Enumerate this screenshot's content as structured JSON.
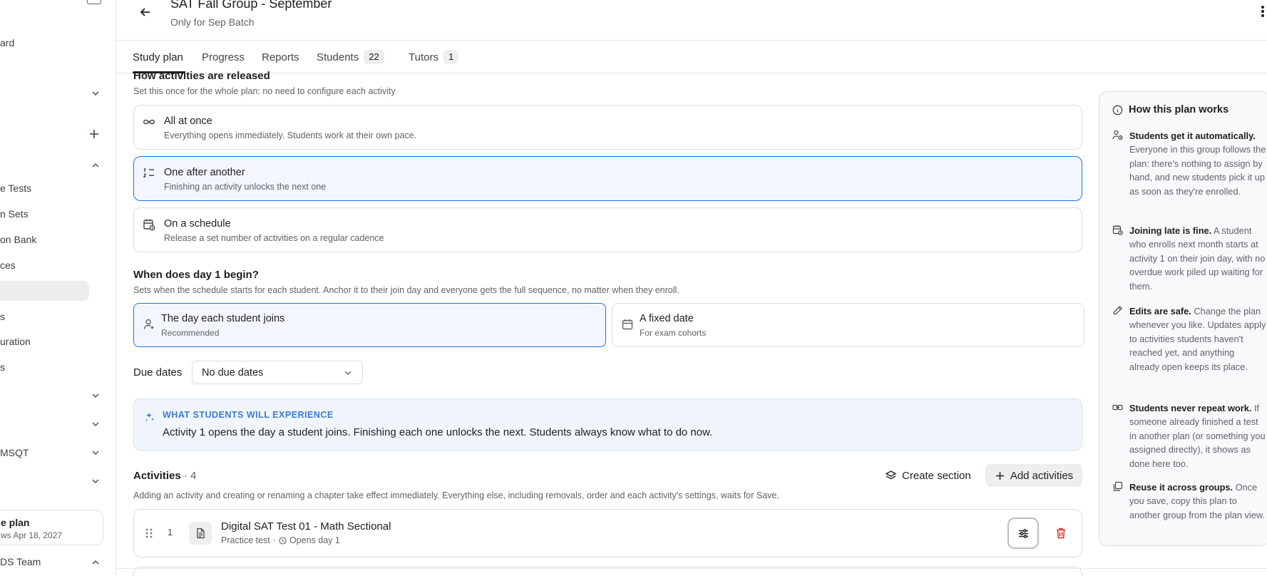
{
  "sidebar": {
    "items": [
      "ard",
      "e Tests",
      "n Sets",
      "on Bank",
      "ces",
      "s",
      "uration",
      "s",
      "MSQT",
      "Team"
    ],
    "plan_card": {
      "title": "e plan",
      "subtitle": "ws Apr 18, 2027"
    },
    "team_label": "DS Team"
  },
  "header": {
    "title": "SAT Fall Group - September",
    "subtitle": "Only for Sep Batch"
  },
  "tabs": [
    {
      "label": "Study plan",
      "badge": ""
    },
    {
      "label": "Progress",
      "badge": ""
    },
    {
      "label": "Reports",
      "badge": ""
    },
    {
      "label": "Students",
      "badge": "22"
    },
    {
      "label": "Tutors",
      "badge": "1"
    }
  ],
  "release": {
    "title": "How activities are released",
    "desc": "Set this once for the whole plan: no need to configure each activity",
    "options": [
      {
        "label": "All at once",
        "sub": "Everything opens immediately. Students work at their own pace.",
        "icon": "infinity-icon"
      },
      {
        "label": "One after another",
        "sub": "Finishing an activity unlocks the next one",
        "icon": "numbered-list-icon",
        "selected": true
      },
      {
        "label": "On a schedule",
        "sub": "Release a set number of activities on a regular cadence",
        "icon": "calendar-clock-icon"
      }
    ]
  },
  "day1": {
    "title": "When does day 1 begin?",
    "desc": "Sets when the schedule starts for each student. Anchor it to their join day and everyone gets the full sequence, no matter when they enroll.",
    "options": [
      {
        "label": "The day each student joins",
        "sub": "Recommended",
        "icon": "user-plus-icon",
        "selected": true
      },
      {
        "label": "A fixed date",
        "sub": "For exam cohorts",
        "icon": "calendar-icon"
      }
    ]
  },
  "due": {
    "label": "Due dates",
    "value": "No due dates"
  },
  "experience": {
    "header": "WHAT STUDENTS WILL EXPERIENCE",
    "text": "Activity 1 opens the day a student joins. Finishing each one unlocks the next. Students always know what to do now."
  },
  "activities": {
    "title": "Activities",
    "count": "· 4",
    "desc": "Adding an activity and creating or renaming a chapter take effect immediately. Everything else, including removals, order and each activity's settings, waits for Save.",
    "create_label": "Create section",
    "add_label": "Add activities",
    "rows": [
      {
        "num": "1",
        "name": "Digital SAT Test 01 - Math Sectional",
        "type": "Practice test",
        "sep": "·",
        "opens": "Opens day 1"
      }
    ]
  },
  "panel": {
    "title": "How this plan works",
    "tips": [
      {
        "icon": "users-auto-icon",
        "bold": "Students get it automatically.",
        "text": " Everyone in this group follows the plan: there's nothing to assign by hand, and new students pick it up as soon as they're enrolled."
      },
      {
        "icon": "calendar-clock-icon",
        "bold": "Joining late is fine.",
        "text": " A student who enrolls next month starts at activity 1 on their join day, with no overdue work piled up waiting for them."
      },
      {
        "icon": "pencil-icon",
        "bold": "Edits are safe.",
        "text": " Change the plan whenever you like. Updates apply to activities students haven't reached yet, and anything already open keeps its place."
      },
      {
        "icon": "link-icon",
        "bold": "Students never repeat work.",
        "text": " If someone already finished a test in another plan (or something you assigned directly), it shows as done here too."
      },
      {
        "icon": "copy-icon",
        "bold": "Reuse it across groups.",
        "text": " Once you save, copy this plan to another group from the plan view."
      }
    ]
  }
}
